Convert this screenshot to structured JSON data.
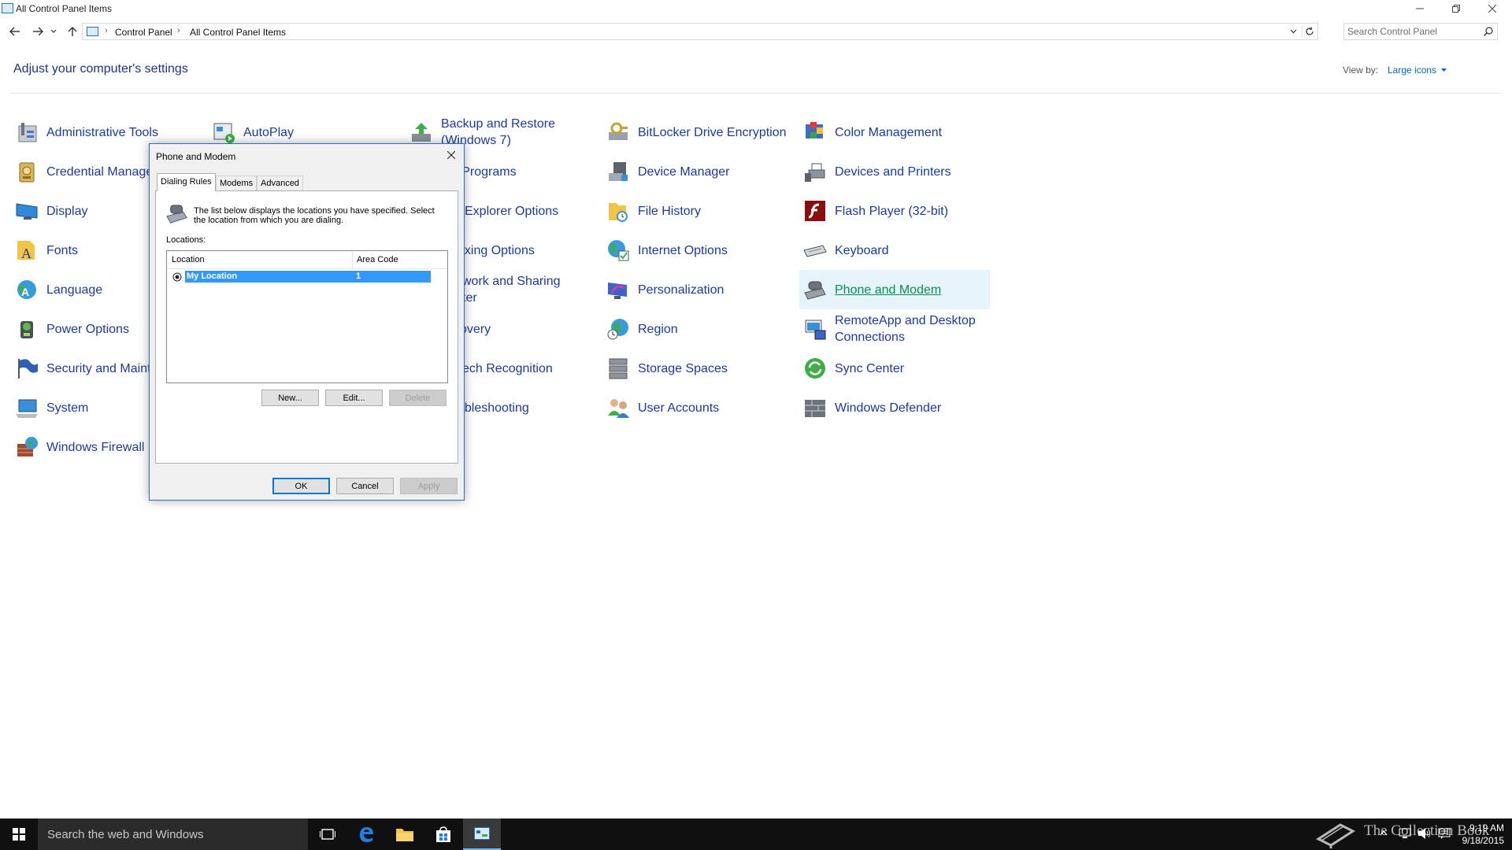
{
  "window": {
    "title": "All Control Panel Items",
    "buttons": [
      "minimize",
      "restore",
      "close"
    ]
  },
  "address": {
    "crumbs": [
      "Control Panel",
      "All Control Panel Items"
    ],
    "search_placeholder": "Search Control Panel"
  },
  "main": {
    "heading": "Adjust your computer's settings",
    "viewby_label": "View by:",
    "viewby_value": "Large icons"
  },
  "items": {
    "c1": [
      "Administrative Tools",
      "Credential Manage",
      "Display",
      "Fonts",
      "Language",
      "Power Options",
      "Security and Maint",
      "System",
      "Windows Firewall"
    ],
    "c2": [
      "AutoPlay"
    ],
    "c3": [
      "Backup and Restore",
      "(Windows 7)",
      "ault Programs",
      "Explorer Options",
      "exing Options",
      "work and Sharing",
      "ter",
      "overy",
      "ech Recognition",
      "ubleshooting"
    ],
    "c4": [
      "BitLocker Drive Encryption",
      "Device Manager",
      "File History",
      "Internet Options",
      "Personalization",
      "Region",
      "Storage Spaces",
      "User Accounts"
    ],
    "c5": [
      "Color Management",
      "Devices and Printers",
      "Flash Player (32-bit)",
      "Keyboard",
      "Phone and Modem",
      "RemoteApp and Desktop",
      "Connections",
      "Sync Center",
      "Windows Defender"
    ]
  },
  "dialog": {
    "title": "Phone and Modem",
    "tabs": [
      "Dialing Rules",
      "Modems",
      "Advanced"
    ],
    "info": "The list below displays the locations you have specified. Select the location from which you are dialing.",
    "locations_label": "Locations:",
    "columns": [
      "Location",
      "Area Code"
    ],
    "rows": [
      {
        "location": "My Location",
        "area_code": "1"
      }
    ],
    "list_buttons": {
      "new": "New...",
      "edit": "Edit...",
      "delete": "Delete"
    },
    "footer_buttons": {
      "ok": "OK",
      "cancel": "Cancel",
      "apply": "Apply"
    }
  },
  "taskbar": {
    "search_placeholder": "Search the web and Windows",
    "watermark": "The Collection Book",
    "time": "9:19 AM",
    "date": "9/18/2015"
  },
  "colors": {
    "link": "#1a3aa0",
    "heading": "#1e3287",
    "highlight": "#e5f3fb",
    "selection": "#3399ff",
    "taskbar": "#101010"
  }
}
